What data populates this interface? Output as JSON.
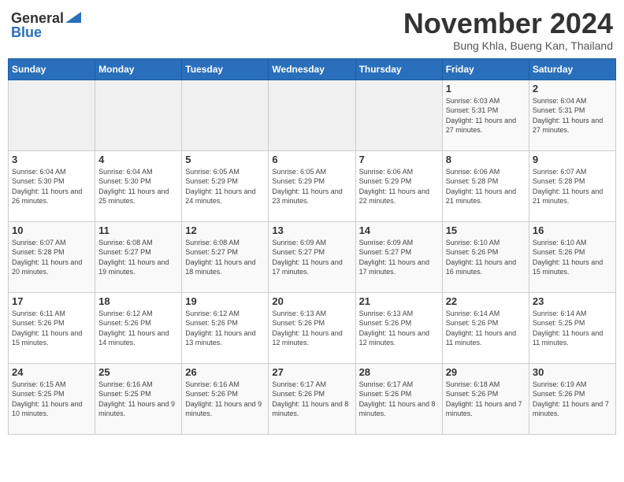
{
  "header": {
    "logo_general": "General",
    "logo_blue": "Blue",
    "month": "November 2024",
    "location": "Bung Khla, Bueng Kan, Thailand"
  },
  "weekdays": [
    "Sunday",
    "Monday",
    "Tuesday",
    "Wednesday",
    "Thursday",
    "Friday",
    "Saturday"
  ],
  "weeks": [
    [
      {
        "day": "",
        "info": ""
      },
      {
        "day": "",
        "info": ""
      },
      {
        "day": "",
        "info": ""
      },
      {
        "day": "",
        "info": ""
      },
      {
        "day": "",
        "info": ""
      },
      {
        "day": "1",
        "info": "Sunrise: 6:03 AM\nSunset: 5:31 PM\nDaylight: 11 hours and 27 minutes."
      },
      {
        "day": "2",
        "info": "Sunrise: 6:04 AM\nSunset: 5:31 PM\nDaylight: 11 hours and 27 minutes."
      }
    ],
    [
      {
        "day": "3",
        "info": "Sunrise: 6:04 AM\nSunset: 5:30 PM\nDaylight: 11 hours and 26 minutes."
      },
      {
        "day": "4",
        "info": "Sunrise: 6:04 AM\nSunset: 5:30 PM\nDaylight: 11 hours and 25 minutes."
      },
      {
        "day": "5",
        "info": "Sunrise: 6:05 AM\nSunset: 5:29 PM\nDaylight: 11 hours and 24 minutes."
      },
      {
        "day": "6",
        "info": "Sunrise: 6:05 AM\nSunset: 5:29 PM\nDaylight: 11 hours and 23 minutes."
      },
      {
        "day": "7",
        "info": "Sunrise: 6:06 AM\nSunset: 5:29 PM\nDaylight: 11 hours and 22 minutes."
      },
      {
        "day": "8",
        "info": "Sunrise: 6:06 AM\nSunset: 5:28 PM\nDaylight: 11 hours and 21 minutes."
      },
      {
        "day": "9",
        "info": "Sunrise: 6:07 AM\nSunset: 5:28 PM\nDaylight: 11 hours and 21 minutes."
      }
    ],
    [
      {
        "day": "10",
        "info": "Sunrise: 6:07 AM\nSunset: 5:28 PM\nDaylight: 11 hours and 20 minutes."
      },
      {
        "day": "11",
        "info": "Sunrise: 6:08 AM\nSunset: 5:27 PM\nDaylight: 11 hours and 19 minutes."
      },
      {
        "day": "12",
        "info": "Sunrise: 6:08 AM\nSunset: 5:27 PM\nDaylight: 11 hours and 18 minutes."
      },
      {
        "day": "13",
        "info": "Sunrise: 6:09 AM\nSunset: 5:27 PM\nDaylight: 11 hours and 17 minutes."
      },
      {
        "day": "14",
        "info": "Sunrise: 6:09 AM\nSunset: 5:27 PM\nDaylight: 11 hours and 17 minutes."
      },
      {
        "day": "15",
        "info": "Sunrise: 6:10 AM\nSunset: 5:26 PM\nDaylight: 11 hours and 16 minutes."
      },
      {
        "day": "16",
        "info": "Sunrise: 6:10 AM\nSunset: 5:26 PM\nDaylight: 11 hours and 15 minutes."
      }
    ],
    [
      {
        "day": "17",
        "info": "Sunrise: 6:11 AM\nSunset: 5:26 PM\nDaylight: 11 hours and 15 minutes."
      },
      {
        "day": "18",
        "info": "Sunrise: 6:12 AM\nSunset: 5:26 PM\nDaylight: 11 hours and 14 minutes."
      },
      {
        "day": "19",
        "info": "Sunrise: 6:12 AM\nSunset: 5:26 PM\nDaylight: 11 hours and 13 minutes."
      },
      {
        "day": "20",
        "info": "Sunrise: 6:13 AM\nSunset: 5:26 PM\nDaylight: 11 hours and 12 minutes."
      },
      {
        "day": "21",
        "info": "Sunrise: 6:13 AM\nSunset: 5:26 PM\nDaylight: 11 hours and 12 minutes."
      },
      {
        "day": "22",
        "info": "Sunrise: 6:14 AM\nSunset: 5:26 PM\nDaylight: 11 hours and 11 minutes."
      },
      {
        "day": "23",
        "info": "Sunrise: 6:14 AM\nSunset: 5:25 PM\nDaylight: 11 hours and 11 minutes."
      }
    ],
    [
      {
        "day": "24",
        "info": "Sunrise: 6:15 AM\nSunset: 5:25 PM\nDaylight: 11 hours and 10 minutes."
      },
      {
        "day": "25",
        "info": "Sunrise: 6:16 AM\nSunset: 5:25 PM\nDaylight: 11 hours and 9 minutes."
      },
      {
        "day": "26",
        "info": "Sunrise: 6:16 AM\nSunset: 5:26 PM\nDaylight: 11 hours and 9 minutes."
      },
      {
        "day": "27",
        "info": "Sunrise: 6:17 AM\nSunset: 5:26 PM\nDaylight: 11 hours and 8 minutes."
      },
      {
        "day": "28",
        "info": "Sunrise: 6:17 AM\nSunset: 5:26 PM\nDaylight: 11 hours and 8 minutes."
      },
      {
        "day": "29",
        "info": "Sunrise: 6:18 AM\nSunset: 5:26 PM\nDaylight: 11 hours and 7 minutes."
      },
      {
        "day": "30",
        "info": "Sunrise: 6:19 AM\nSunset: 5:26 PM\nDaylight: 11 hours and 7 minutes."
      }
    ]
  ]
}
